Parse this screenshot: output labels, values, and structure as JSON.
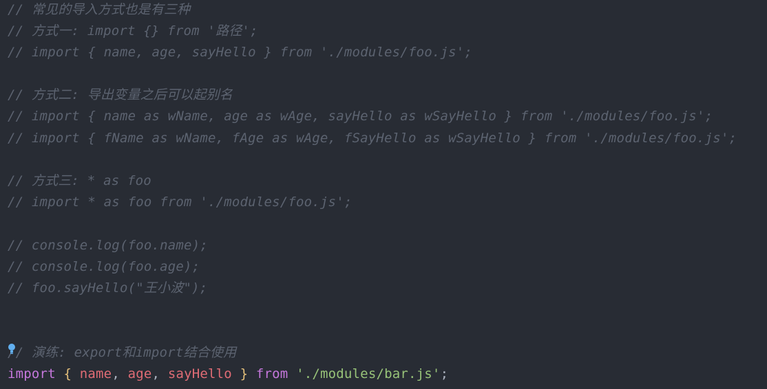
{
  "editor": {
    "comments": [
      "// 常见的导入方式也是有三种",
      "// 方式一: import {} from '路径';",
      "// import { name, age, sayHello } from './modules/foo.js';",
      "// 方式二: 导出变量之后可以起别名",
      "// import { name as wName, age as wAge, sayHello as wSayHello } from './modules/foo.js';",
      "// import { fName as wName, fAge as wAge, fSayHello as wSayHello } from './modules/foo.js';",
      "// 方式三: * as foo",
      "// import * as foo from './modules/foo.js';",
      "// console.log(foo.name);",
      "// console.log(foo.age);",
      "// foo.sayHello(\"王小波\");",
      "// 演练: export和import结合使用"
    ],
    "code_line": {
      "keyword_import": "import",
      "open_brace": "{",
      "name": "name",
      "comma1": ",",
      "age": "age",
      "comma2": ",",
      "sayhello": "sayHello",
      "close_brace": "}",
      "keyword_from": "from",
      "module_path": "'./modules/bar.js'",
      "semicolon": ";"
    },
    "lightbulb_icon": "lightbulb-icon",
    "colors": {
      "background": "#282c34",
      "comment": "#5c6370",
      "keyword": "#c678dd",
      "brace": "#e5c07b",
      "variable": "#e06c75",
      "string": "#98c379",
      "punctuation": "#abb2bf",
      "lightbulb": "#61afef"
    }
  }
}
